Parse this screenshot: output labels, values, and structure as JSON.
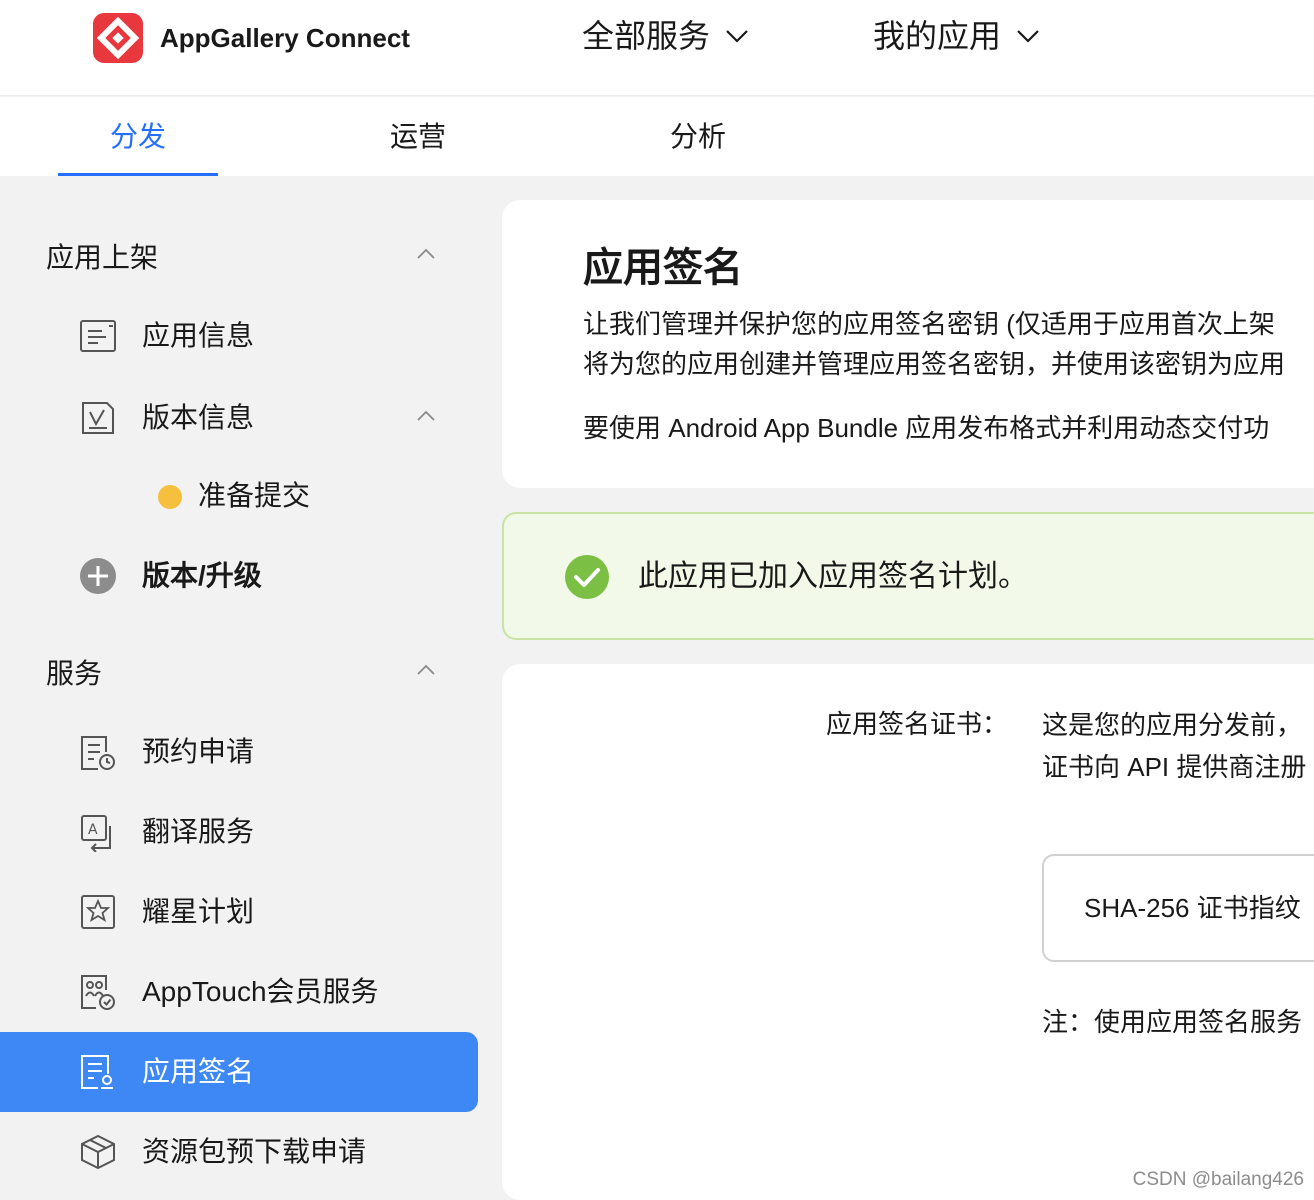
{
  "header": {
    "brand": "AppGallery Connect",
    "nav": [
      "全部服务",
      "我的应用"
    ]
  },
  "tabs": [
    {
      "label": "分发",
      "active": true
    },
    {
      "label": "运营",
      "active": false
    },
    {
      "label": "分析",
      "active": false
    }
  ],
  "sidebar": {
    "section1": {
      "title": "应用上架",
      "items": [
        {
          "label": "应用信息",
          "icon": "app-info-icon"
        },
        {
          "label": "版本信息",
          "icon": "version-info-icon"
        },
        {
          "label": "准备提交",
          "status_color": "#f6bf3d"
        },
        {
          "label": "版本/升级",
          "icon": "plus-circle-icon"
        }
      ]
    },
    "section2": {
      "title": "服务",
      "items": [
        {
          "label": "预约申请",
          "icon": "reservation-icon"
        },
        {
          "label": "翻译服务",
          "icon": "translation-icon"
        },
        {
          "label": "耀星计划",
          "icon": "star-plan-icon"
        },
        {
          "label": "AppTouch会员服务",
          "icon": "member-service-icon"
        },
        {
          "label": "应用签名",
          "icon": "app-signing-icon",
          "active": true
        },
        {
          "label": "资源包预下载申请",
          "icon": "package-icon"
        }
      ]
    }
  },
  "main": {
    "title": "应用签名",
    "desc_line1": "让我们管理并保护您的应用签名密钥 (仅适用于应用首次上架",
    "desc_line2": "将为您的应用创建并管理应用签名密钥，并使用该密钥为应用",
    "desc_line3": "要使用 Android App Bundle 应用发布格式并利用动态交付功",
    "success_message": "此应用已加入应用签名计划。",
    "cert_label": "应用签名证书：",
    "cert_text_line1": "这是您的应用分发前，",
    "cert_text_line2": "证书向 API 提供商注册",
    "cert_box": "SHA-256 证书指纹",
    "note": "注：使用应用签名服务"
  },
  "watermark": "CSDN @bailang426",
  "colors": {
    "accent": "#256fff",
    "active_menu": "#3d88f5",
    "success": "#7bbf45",
    "logo": "#e8383d"
  }
}
